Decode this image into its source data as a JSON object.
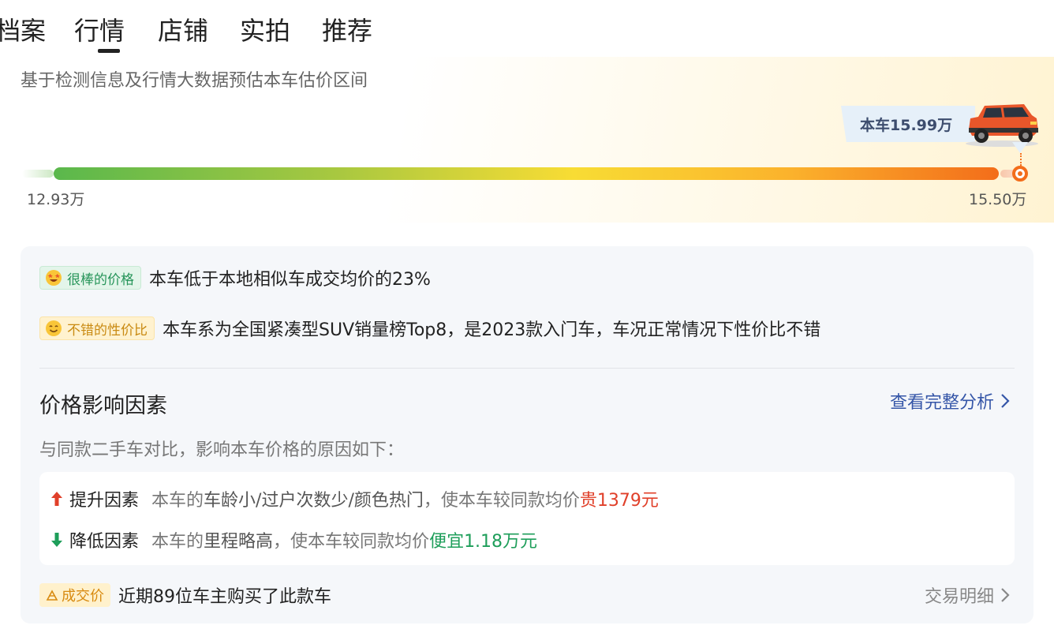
{
  "tabs": [
    {
      "label": "档案"
    },
    {
      "label": "行情"
    },
    {
      "label": "店铺"
    },
    {
      "label": "实拍"
    },
    {
      "label": "推荐"
    }
  ],
  "active_tab": "行情",
  "estimate": {
    "subtitle": "基于检测信息及行情大数据预估本车估价区间",
    "car_price_label": "本车15.99万",
    "min_label": "12.93万",
    "max_label": "15.50万",
    "marker_position": 1.0
  },
  "highlights": [
    {
      "badge": "很棒的价格",
      "text": "本车低于本地相似车成交均价的23%"
    },
    {
      "badge": "不错的性价比",
      "text": "本车系为全国紧凑型SUV销量榜Top8，是2023款入门车，车况正常情况下性价比不错"
    }
  ],
  "factors_section": {
    "title": "价格影响因素",
    "link": "查看完整分析",
    "subtitle": "与同款二手车对比，影响本车价格的原因如下：",
    "up": {
      "title": "提升因素",
      "prefix": "本车的",
      "items": "车龄小/过户次数少/颜色热门",
      "mid": "，使本车较同款均价",
      "highlight": "贵1379元"
    },
    "down": {
      "title": "降低因素",
      "prefix": "本车的",
      "items": "里程略高",
      "mid": "，使本车较同款均价",
      "highlight": "便宜1.18万元"
    }
  },
  "deal": {
    "badge": "成交价",
    "text": "近期89位车主购买了此款车",
    "link": "交易明细"
  },
  "colors": {
    "accent_orange": "#f36d1a",
    "link_blue": "#3556a8",
    "up_red": "#e0402a",
    "down_green": "#1e9e5a"
  }
}
